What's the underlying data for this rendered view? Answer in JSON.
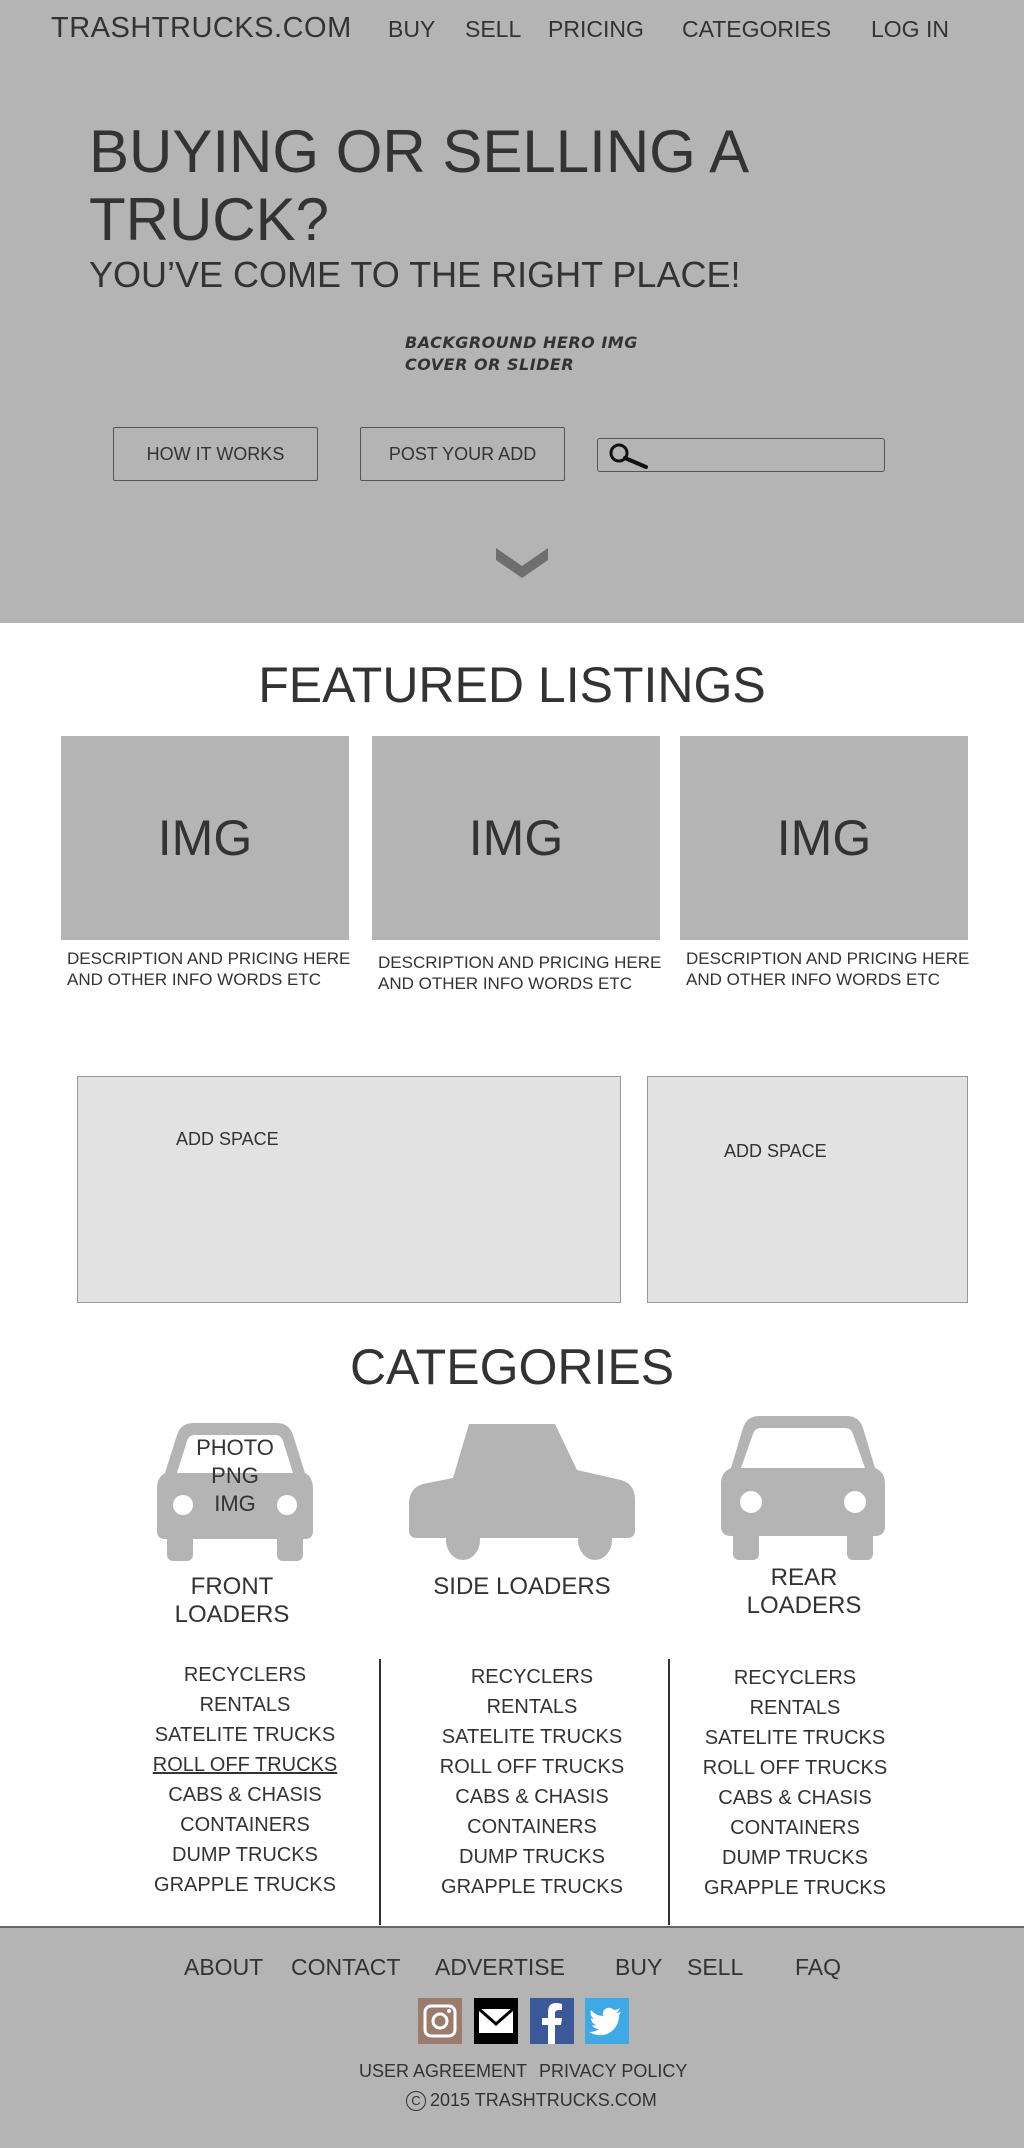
{
  "header": {
    "logo": "TRASHTRUCKS.COM",
    "nav": [
      "BUY",
      "SELL",
      "PRICING",
      "CATEGORIES",
      "LOG IN"
    ]
  },
  "hero": {
    "title": "BUYING OR SELLING A TRUCK?",
    "subtitle": "YOU’VE COME TO THE RIGHT PLACE!",
    "note_line1": "BACKGROUND HERO IMG",
    "note_line2": "COVER OR SLIDER",
    "how_it_works": "HOW IT WORKS",
    "post_ad": "POST YOUR ADD",
    "search_placeholder": ""
  },
  "featured": {
    "title": "FEATURED LISTINGS",
    "listings": [
      {
        "img": "IMG",
        "desc": "DESCRIPTION AND PRICING HERE AND OTHER INFO WORDS ETC"
      },
      {
        "img": "IMG",
        "desc": "DESCRIPTION AND PRICING HERE AND OTHER INFO WORDS ETC"
      },
      {
        "img": "IMG",
        "desc": "DESCRIPTION AND PRICING HERE AND OTHER INFO WORDS ETC"
      }
    ]
  },
  "ads": [
    "ADD SPACE",
    "ADD SPACE"
  ],
  "categories": {
    "title": "CATEGORIES",
    "photo_line1": "PHOTO",
    "photo_line2": "PNG",
    "photo_line3": "IMG",
    "groups": [
      {
        "line1": "FRONT",
        "line2": "LOADERS"
      },
      {
        "line1": "SIDE LOADERS",
        "line2": ""
      },
      {
        "line1": "REAR",
        "line2": "LOADERS"
      }
    ],
    "subcategories": [
      "RECYCLERS",
      "RENTALS",
      "SATELITE TRUCKS",
      "ROLL OFF TRUCKS",
      "CABS & CHASIS",
      "CONTAINERS",
      "DUMP TRUCKS",
      "GRAPPLE TRUCKS"
    ]
  },
  "footer": {
    "nav": [
      "ABOUT",
      "CONTACT",
      "ADVERTISE",
      "BUY",
      "SELL",
      "FAQ"
    ],
    "user_agreement": "USER AGREEMENT",
    "privacy_policy": "PRIVACY POLICY",
    "copyright": "2015 TRASHTRUCKS.COM"
  },
  "colors": {
    "hero_bg": "#b4b4b4",
    "ad_bg": "#e2e2e2",
    "text": "#333333",
    "instagram": "#9a7b6c",
    "facebook": "#3b5998",
    "twitter": "#3fa9e6"
  },
  "icons": [
    "search-icon",
    "chevron-down-icon",
    "car-icon",
    "instagram-icon",
    "mail-icon",
    "facebook-icon",
    "twitter-icon"
  ]
}
